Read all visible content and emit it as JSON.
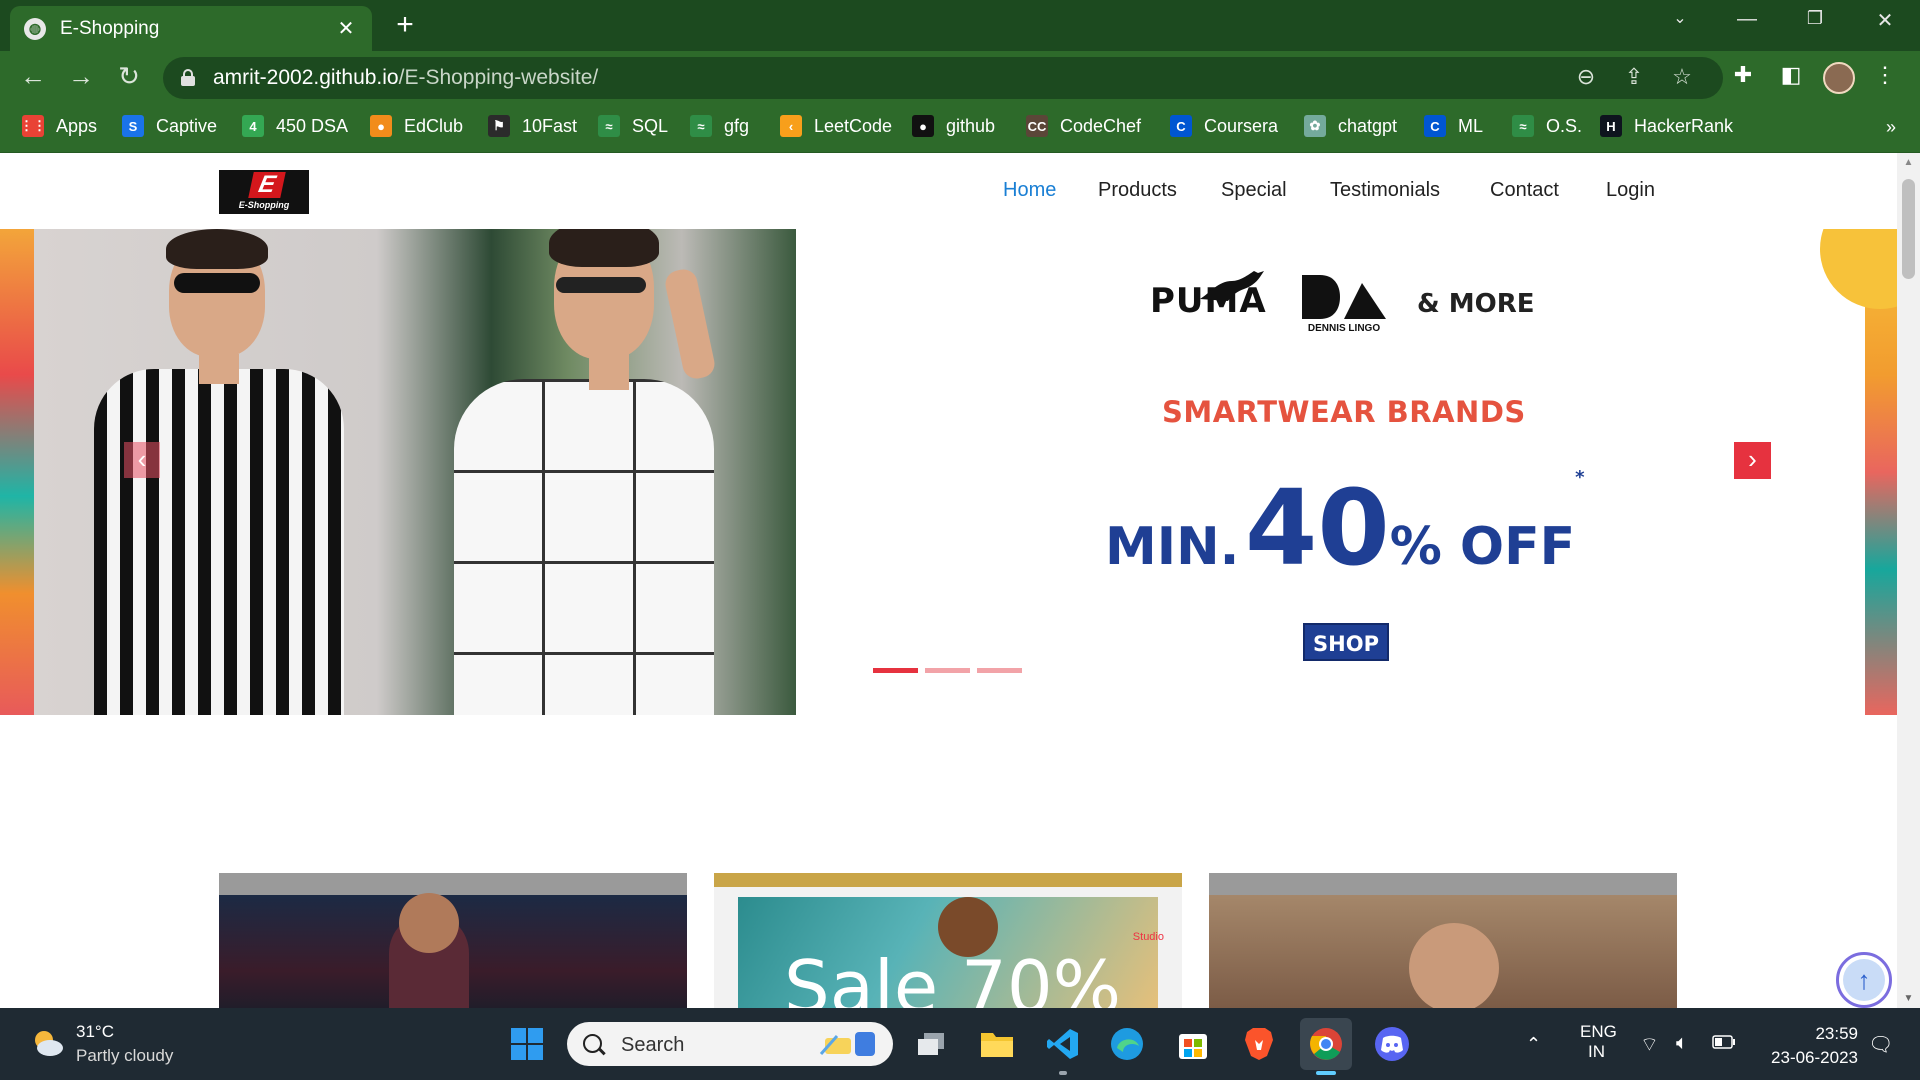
{
  "browser": {
    "tab_title": "E-Shopping",
    "url_host": "amrit-2002.github.io",
    "url_path": "/E-Shopping-website/",
    "colors": {
      "tabstrip": "#1c4a1f",
      "toolbar": "#2d6a2a"
    }
  },
  "bookmarks": [
    {
      "label": "Apps",
      "icon": "apps-grid-icon",
      "color": "#e94235"
    },
    {
      "label": "Captive",
      "icon": "s-square-icon",
      "color": "#1a73e8",
      "glyph": "S"
    },
    {
      "label": "450 DSA",
      "icon": "four-square-icon",
      "color": "#34a853",
      "glyph": "4"
    },
    {
      "label": "EdClub",
      "icon": "edclub-icon",
      "color": "#f28c1b",
      "glyph": "●"
    },
    {
      "label": "10Fast",
      "icon": "10fast-icon",
      "color": "#2b2b2b",
      "glyph": "⚑"
    },
    {
      "label": "SQL",
      "icon": "gfg-icon",
      "color": "#2f8d46",
      "glyph": "≈"
    },
    {
      "label": "gfg",
      "icon": "gfg-icon",
      "color": "#2f8d46",
      "glyph": "≈"
    },
    {
      "label": "LeetCode",
      "icon": "leetcode-icon",
      "color": "#f89f1b",
      "glyph": "‹"
    },
    {
      "label": "github",
      "icon": "github-icon",
      "color": "#111111",
      "glyph": "●"
    },
    {
      "label": "CodeChef",
      "icon": "codechef-icon",
      "color": "#5b4638",
      "glyph": "CC"
    },
    {
      "label": "Coursera",
      "icon": "coursera-icon",
      "color": "#0056d2",
      "glyph": "C"
    },
    {
      "label": "chatgpt",
      "icon": "chatgpt-icon",
      "color": "#74aa9c",
      "glyph": "✿"
    },
    {
      "label": "ML",
      "icon": "coursera-icon",
      "color": "#0056d2",
      "glyph": "C"
    },
    {
      "label": "O.S.",
      "icon": "gfg-icon",
      "color": "#2f8d46",
      "glyph": "≈"
    },
    {
      "label": "HackerRank",
      "icon": "hackerrank-icon",
      "color": "#0e141e",
      "glyph": "H"
    }
  ],
  "bookmarks_more": "»",
  "site": {
    "logo_letter": "E",
    "logo_text": "E-Shopping",
    "nav": [
      {
        "label": "Home",
        "active": true
      },
      {
        "label": "Products"
      },
      {
        "label": "Special"
      },
      {
        "label": "Testimonials"
      },
      {
        "label": "Contact"
      },
      {
        "label": "Login"
      }
    ],
    "nav_active_color": "#1a7fd4"
  },
  "hero": {
    "brand_1": "PUMA",
    "brand_2_caption": "DENNIS LINGO",
    "brand_more": "& MORE",
    "tagline": "SMARTWEAR BRANDS",
    "offer_prefix": "MIN.",
    "offer_value": "40",
    "offer_suffix": "% OFF",
    "offer_mark": "*",
    "shop_label": "SHOP",
    "prev_glyph": "‹",
    "next_glyph": "›",
    "slides_total": 3,
    "slide_active": 1,
    "indicator_active_color": "#e6323f",
    "indicator_color": "#f2a3a8"
  },
  "cards": {
    "card_2_title": "Sale 70%",
    "card_2_badge": "Studio"
  },
  "back_to_top_glyph": "↑",
  "taskbar": {
    "weather_temp": "31°C",
    "weather_desc": "Partly cloudy",
    "search_label": "Search",
    "lang_1": "ENG",
    "lang_2": "IN",
    "time": "23:59",
    "date": "23-06-2023"
  }
}
